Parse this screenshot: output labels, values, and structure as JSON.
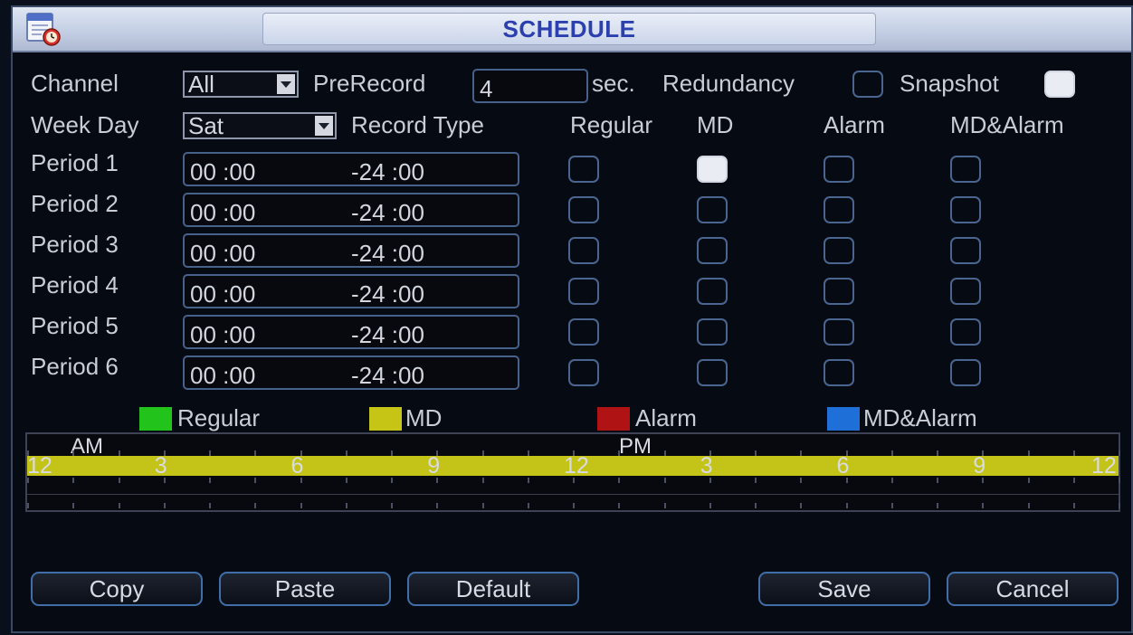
{
  "window": {
    "title": "SCHEDULE"
  },
  "top": {
    "channel_label": "Channel",
    "channel_value": "All",
    "prerecord_label": "PreRecord",
    "prerecord_value": "4",
    "sec_label": "sec.",
    "redundancy_label": "Redundancy",
    "redundancy_checked": false,
    "snapshot_label": "Snapshot",
    "snapshot_checked": true
  },
  "weekday": {
    "label": "Week Day",
    "value": "Sat",
    "record_type_label": "Record Type"
  },
  "columns": [
    "Regular",
    "MD",
    "Alarm",
    "MD&Alarm"
  ],
  "periods": [
    {
      "label": "Period 1",
      "start": "00 :00",
      "end": "-24 :00",
      "checks": [
        false,
        true,
        false,
        false
      ]
    },
    {
      "label": "Period 2",
      "start": "00 :00",
      "end": "-24 :00",
      "checks": [
        false,
        false,
        false,
        false
      ]
    },
    {
      "label": "Period 3",
      "start": "00 :00",
      "end": "-24 :00",
      "checks": [
        false,
        false,
        false,
        false
      ]
    },
    {
      "label": "Period 4",
      "start": "00 :00",
      "end": "-24 :00",
      "checks": [
        false,
        false,
        false,
        false
      ]
    },
    {
      "label": "Period 5",
      "start": "00 :00",
      "end": "-24 :00",
      "checks": [
        false,
        false,
        false,
        false
      ]
    },
    {
      "label": "Period 6",
      "start": "00 :00",
      "end": "-24 :00",
      "checks": [
        false,
        false,
        false,
        false
      ]
    }
  ],
  "legend": [
    {
      "label": "Regular",
      "color": "#22c41c"
    },
    {
      "label": "MD",
      "color": "#c6c414"
    },
    {
      "label": "Alarm",
      "color": "#b01313"
    },
    {
      "label": "MD&Alarm",
      "color": "#1e6fd8"
    }
  ],
  "timeline": {
    "am_label": "AM",
    "pm_label": "PM",
    "hour_labels": [
      "12",
      "3",
      "6",
      "9",
      "12",
      "3",
      "6",
      "9",
      "12"
    ],
    "bar_color": "#c4c318",
    "bar_type": "MD"
  },
  "buttons": {
    "copy": "Copy",
    "paste": "Paste",
    "default": "Default",
    "save": "Save",
    "cancel": "Cancel"
  }
}
